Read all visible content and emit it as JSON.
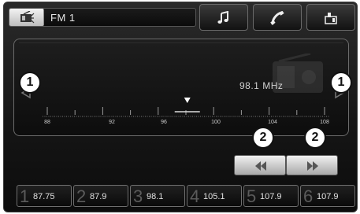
{
  "header": {
    "source_label": "FM 1",
    "source_icon": "radio-source-icon",
    "buttons": [
      {
        "name": "music-button",
        "icon": "music-note-icon"
      },
      {
        "name": "phone-button",
        "icon": "phone-icon"
      },
      {
        "name": "settings-button",
        "icon": "settings-icon"
      }
    ]
  },
  "tuner": {
    "frequency_value": "98.1",
    "frequency_unit": "MHz",
    "scale_labels": [
      "88",
      "92",
      "96",
      "100",
      "104",
      "108"
    ],
    "current_frequency": 98.1
  },
  "callouts": {
    "left": "1",
    "right": "1",
    "seek_back": "2",
    "seek_forward": "2"
  },
  "presets": [
    {
      "num": "1",
      "freq": "87.75"
    },
    {
      "num": "2",
      "freq": "87.9"
    },
    {
      "num": "3",
      "freq": "98.1"
    },
    {
      "num": "4",
      "freq": "105.1"
    },
    {
      "num": "5",
      "freq": "107.9"
    },
    {
      "num": "6",
      "freq": "107.9"
    }
  ],
  "colors": {
    "background": "#151515",
    "text": "#e0e0e0",
    "button_light": "#f0f0f0",
    "border": "#6b6b6b"
  }
}
